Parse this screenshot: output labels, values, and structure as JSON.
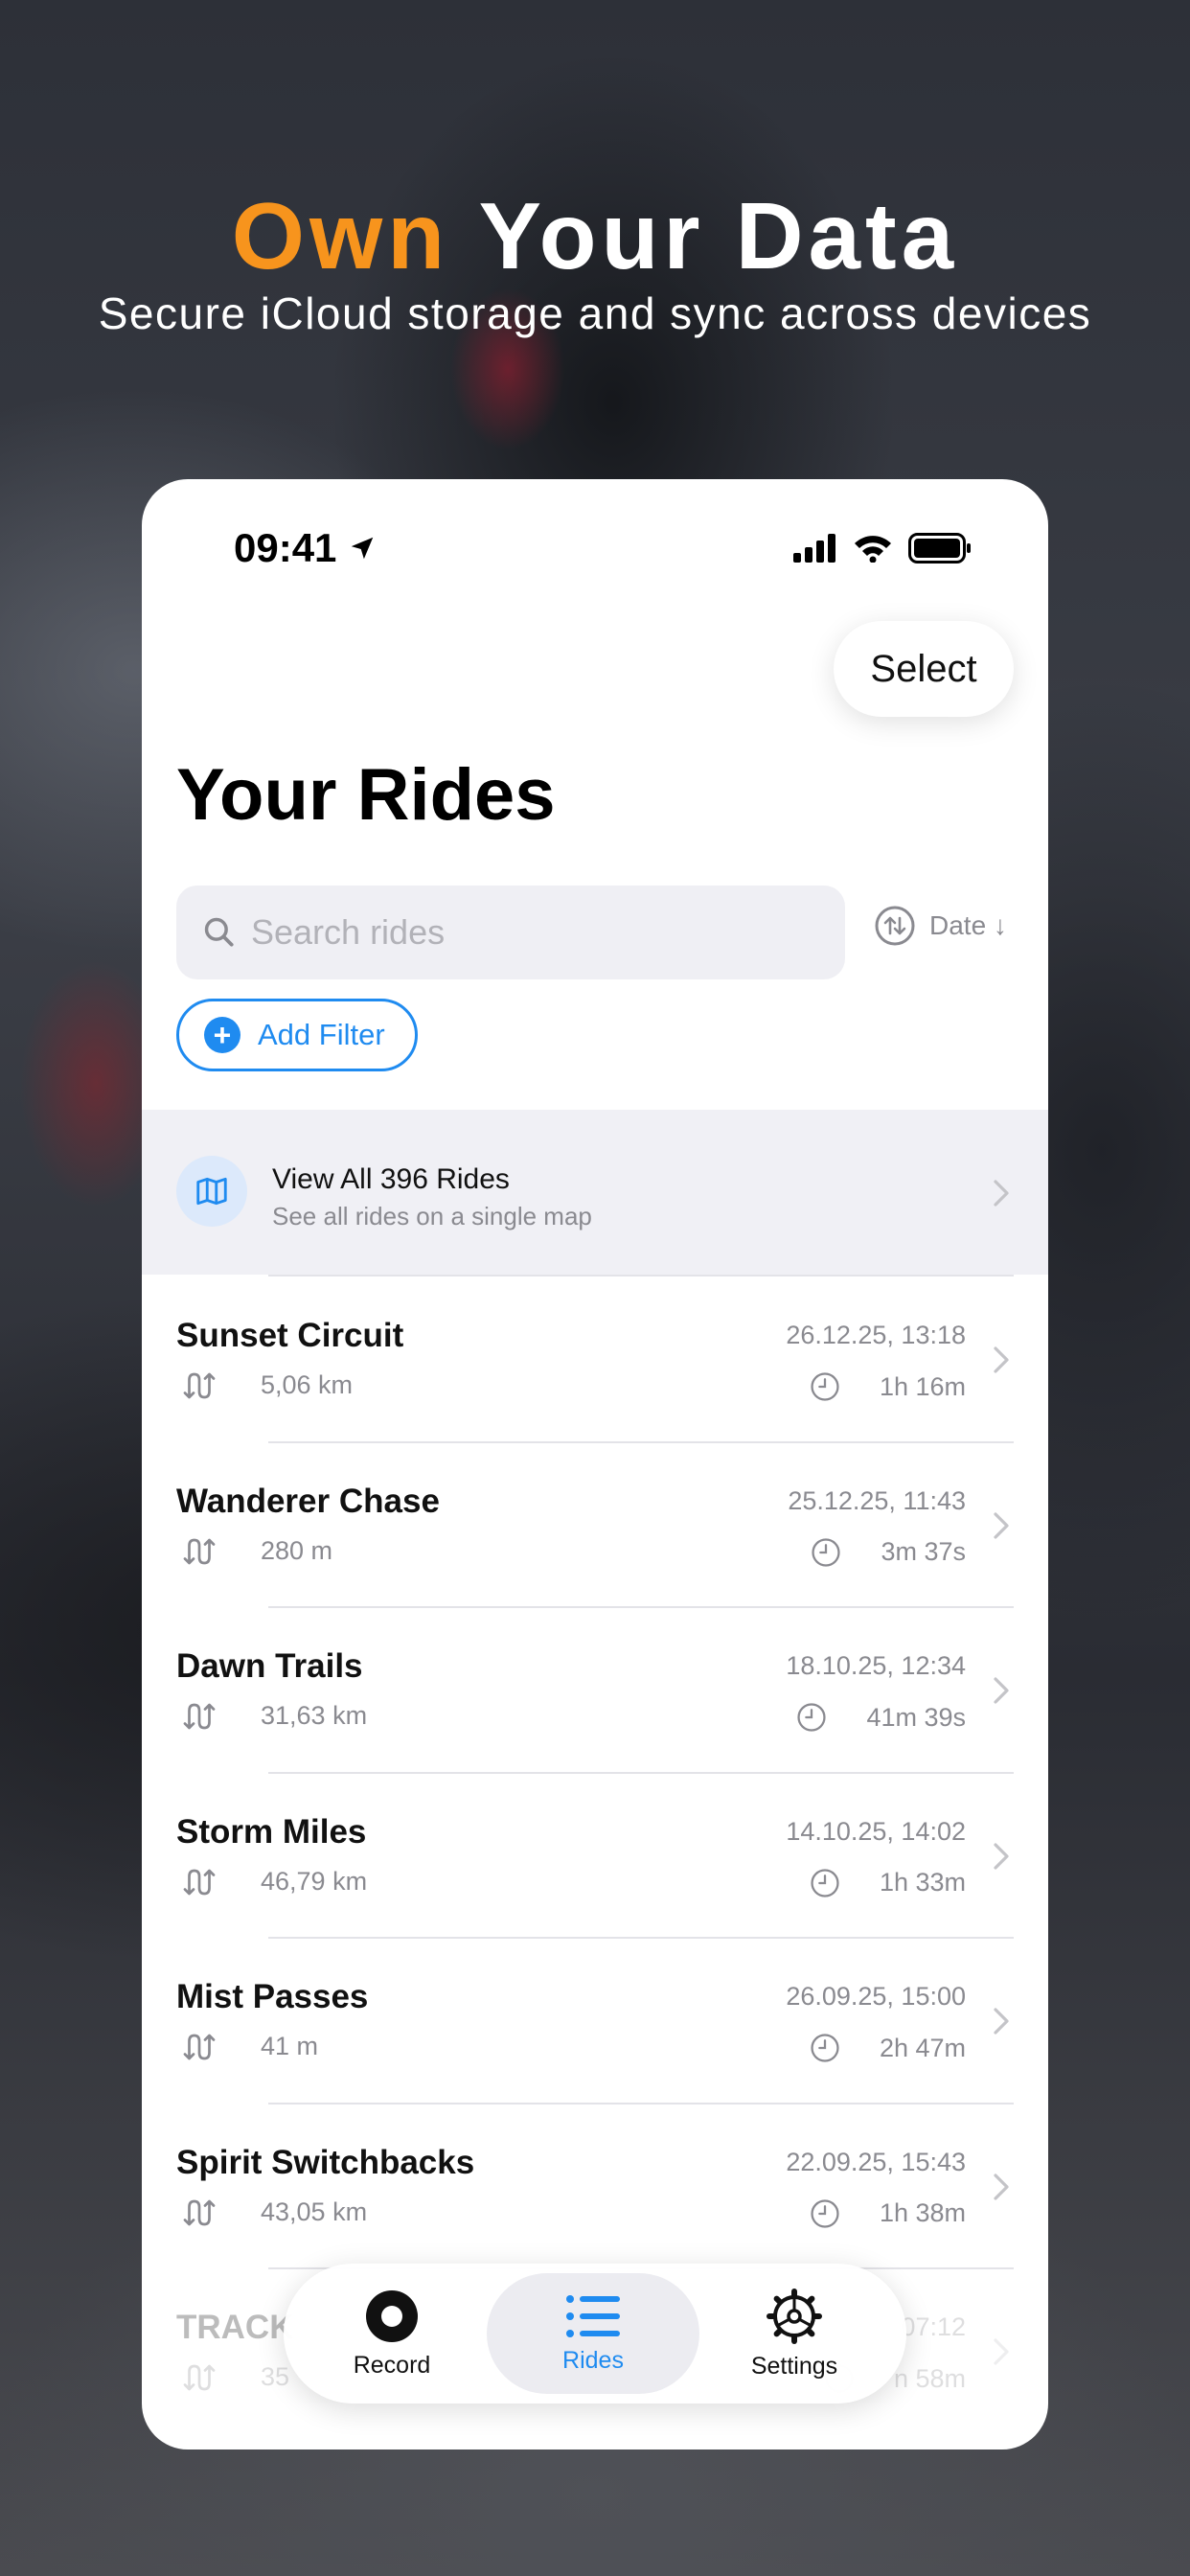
{
  "hero": {
    "headline_accent": "Own",
    "headline_rest": "Your Data",
    "subheadline": "Secure iCloud storage and sync across devices"
  },
  "status_bar": {
    "time": "09:41"
  },
  "header": {
    "select_label": "Select",
    "title": "Your Rides"
  },
  "search": {
    "placeholder": "Search rides",
    "sort_label": "Date ↓"
  },
  "filter": {
    "add_label": "Add Filter"
  },
  "map_row": {
    "title": "View All 396 Rides",
    "subtitle": "See all rides on a single map"
  },
  "rides": [
    {
      "name": "Sunset Circuit",
      "distance": "5,06 km",
      "date": "26.12.25, 13:18",
      "duration": "1h 16m"
    },
    {
      "name": "Wanderer Chase",
      "distance": "280 m",
      "date": "25.12.25, 11:43",
      "duration": "3m 37s"
    },
    {
      "name": "Dawn Trails",
      "distance": "31,63 km",
      "date": "18.10.25, 12:34",
      "duration": "41m 39s"
    },
    {
      "name": "Storm Miles",
      "distance": "46,79 km",
      "date": "14.10.25, 14:02",
      "duration": "1h 33m"
    },
    {
      "name": "Mist Passes",
      "distance": "41 m",
      "date": "26.09.25, 15:00",
      "duration": "2h 47m"
    },
    {
      "name": "Spirit Switchbacks",
      "distance": "43,05 km",
      "date": "22.09.25, 15:43",
      "duration": "1h 38m"
    },
    {
      "name": "TRACK",
      "distance": "35",
      "date": "07:12",
      "duration": "n 58m"
    }
  ],
  "tabs": [
    {
      "label": "Record",
      "icon": "record-icon"
    },
    {
      "label": "Rides",
      "icon": "list-icon",
      "active": true
    },
    {
      "label": "Settings",
      "icon": "gear-icon"
    }
  ],
  "colors": {
    "accent_orange": "#f7941d",
    "accent_blue": "#1f8bf0"
  }
}
